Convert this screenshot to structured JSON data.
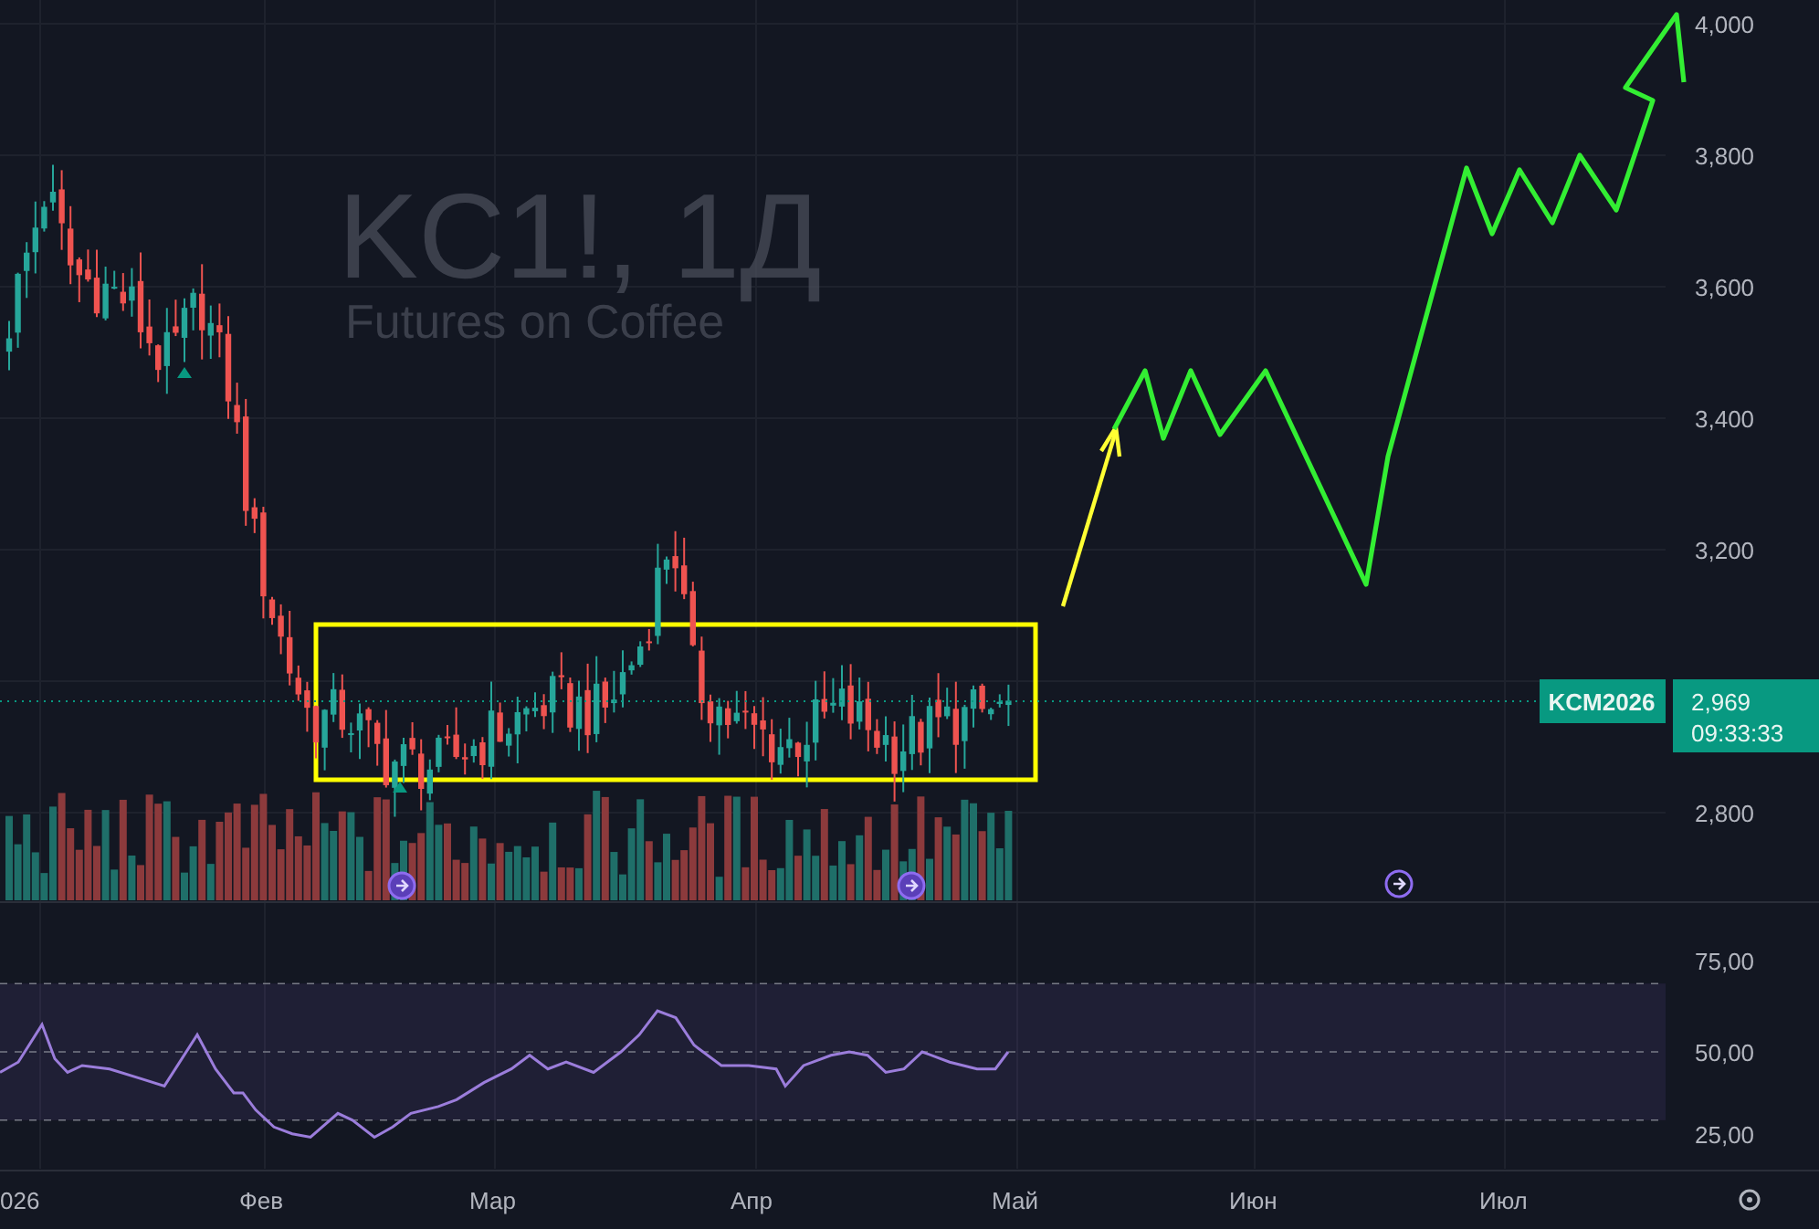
{
  "watermark": {
    "title": "KC1!, 1Д",
    "subtitle": "Futures on Coffee"
  },
  "price_axis": [
    "4,000",
    "3,800",
    "3,600",
    "3,400",
    "3,200",
    "2,800"
  ],
  "rsi_axis": [
    "75,00",
    "50,00",
    "25,00"
  ],
  "time_axis": [
    "026",
    "Фев",
    "Мар",
    "Апр",
    "Май",
    "Июн",
    "Июл"
  ],
  "last_price": {
    "symbol": "KCM2026",
    "price": "2,969",
    "countdown": "09:33:33"
  }
}
